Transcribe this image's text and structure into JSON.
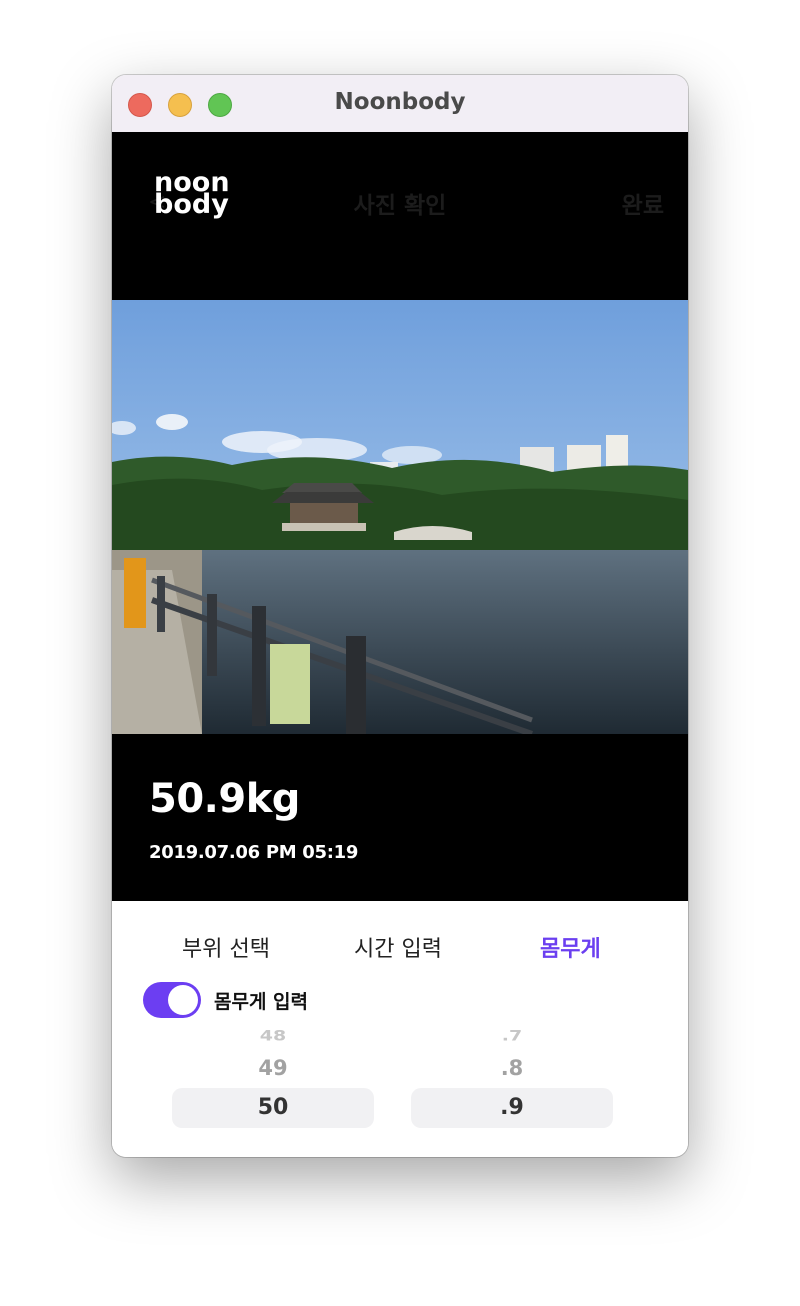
{
  "window": {
    "title": "Noonbody"
  },
  "header": {
    "logo_line1": "noon",
    "logo_line2": "body",
    "back_icon": "<",
    "title": "사진 확인",
    "done_label": "완료"
  },
  "photo": {
    "icon": "park-pavilion-photo"
  },
  "info": {
    "weight": "50.9kg",
    "datetime": "2019.07.06  PM 05:19"
  },
  "tabs": [
    {
      "label": "부위 선택"
    },
    {
      "label": "시간 입력"
    },
    {
      "label": "몸무게"
    }
  ],
  "toggle": {
    "label": "몸무게 입력",
    "on": true
  },
  "picker": {
    "integer": [
      "48",
      "49",
      "50"
    ],
    "decimal": [
      ".7",
      ".8",
      ".9"
    ]
  },
  "colors": {
    "accent": "#6c3ef2",
    "header_bg": "#000000"
  }
}
